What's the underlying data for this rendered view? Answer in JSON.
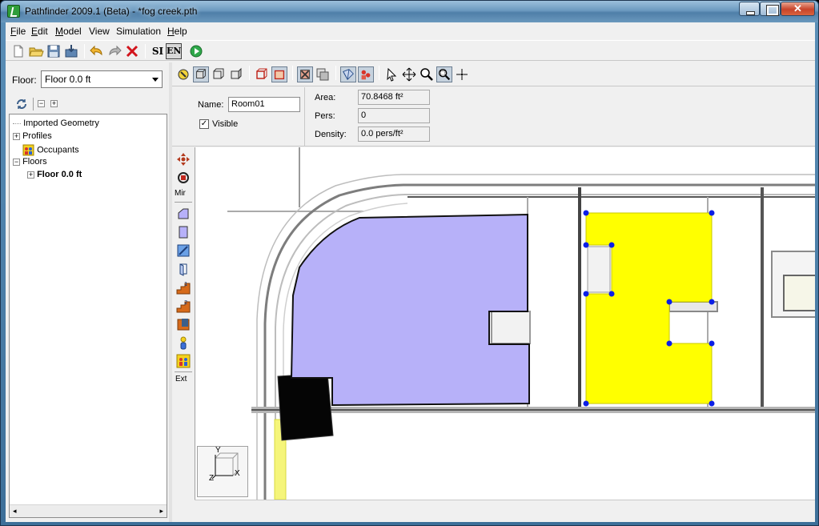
{
  "window": {
    "title": "Pathfinder 2009.1 (Beta) - *fog creek.pth"
  },
  "menu": [
    {
      "label": "File",
      "mnemonic": "F",
      "rest": "ile"
    },
    {
      "label": "Edit",
      "mnemonic": "E",
      "rest": "dit"
    },
    {
      "label": "Model",
      "mnemonic": "M",
      "rest": "odel"
    },
    {
      "label": "View",
      "mnemonic": "",
      "rest": "View"
    },
    {
      "label": "Simulation",
      "mnemonic": "",
      "rest": "Simulation"
    },
    {
      "label": "Help",
      "mnemonic": "H",
      "rest": "elp"
    }
  ],
  "toolbar": {
    "si_label": "SI",
    "en_label": "EN"
  },
  "floor": {
    "label": "Floor:",
    "selected": "Floor 0.0 ft"
  },
  "tree": {
    "items": [
      {
        "label": "Imported Geometry"
      },
      {
        "label": "Profiles"
      },
      {
        "label": "Occupants"
      },
      {
        "label": "Floors"
      },
      {
        "label": "Floor 0.0 ft"
      }
    ]
  },
  "properties": {
    "name_label": "Name:",
    "name_value": "Room01",
    "visible_label": "Visible",
    "area_label": "Area:",
    "area_value": "70.8468 ft²",
    "pers_label": "Pers:",
    "pers_value": "0",
    "density_label": "Density:",
    "density_value": "0.0 pers/ft²"
  },
  "vertical_tools": {
    "mir_label": "Mir",
    "ext_label": "Ext"
  },
  "axes": {
    "y": "Y",
    "x": "X",
    "z": "Z"
  },
  "colors": {
    "room_fill": "#b7b1f9",
    "selected_room": "#ffff00",
    "vertex": "#0000ee"
  }
}
